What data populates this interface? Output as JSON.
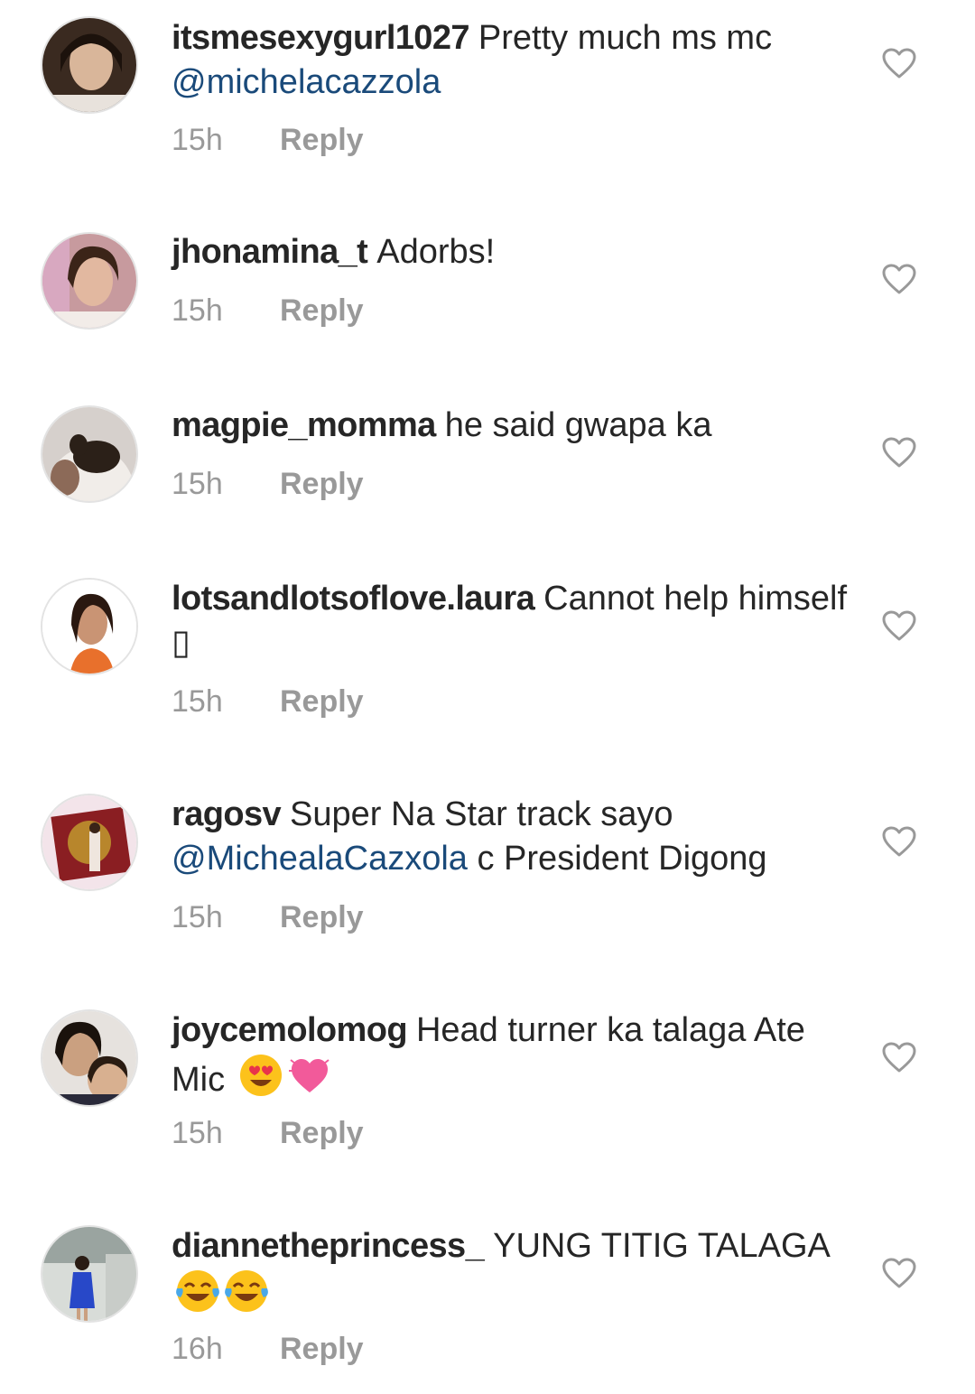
{
  "comments": [
    {
      "username": "itsmesexygurl1027",
      "text": "Pretty much ms mc",
      "mention": "@michelacazzola",
      "text_after": "",
      "time": "15h",
      "reply_label": "Reply",
      "avatar_icon": "profile-photo"
    },
    {
      "username": "jhonamina_t",
      "text": "Adorbs!",
      "time": "15h",
      "reply_label": "Reply",
      "avatar_icon": "profile-photo"
    },
    {
      "username": "magpie_momma",
      "text": "he said gwapa ka",
      "time": "15h",
      "reply_label": "Reply",
      "avatar_icon": "profile-photo"
    },
    {
      "username": "lotsandlotsoflove.laura",
      "text": "Cannot help himself",
      "glyph": "▯",
      "time": "15h",
      "reply_label": "Reply",
      "avatar_icon": "profile-photo"
    },
    {
      "username": "ragosv",
      "text": "Super Na Star track sayo",
      "mention": "@MichealaCazxola",
      "text_after": "c President Digong",
      "time": "15h",
      "reply_label": "Reply",
      "avatar_icon": "profile-photo"
    },
    {
      "username": "joycemolomog",
      "text": "Head turner ka talaga Ate Mic",
      "emojis": [
        "heart-eyes-emoji",
        "growing-heart-emoji"
      ],
      "time": "15h",
      "reply_label": "Reply",
      "avatar_icon": "profile-photo"
    },
    {
      "username": "diannetheprincess_",
      "text": "YUNG TITIG TALAGA",
      "emojis": [
        "tears-of-joy-emoji",
        "tears-of-joy-emoji"
      ],
      "time": "16h",
      "reply_label": "Reply",
      "avatar_icon": "profile-photo"
    }
  ],
  "icons": {
    "like": "heart-outline-icon"
  },
  "colors": {
    "text": "#262626",
    "mention": "#1a4a7a",
    "meta": "#999999",
    "heart_stroke": "#999999"
  }
}
